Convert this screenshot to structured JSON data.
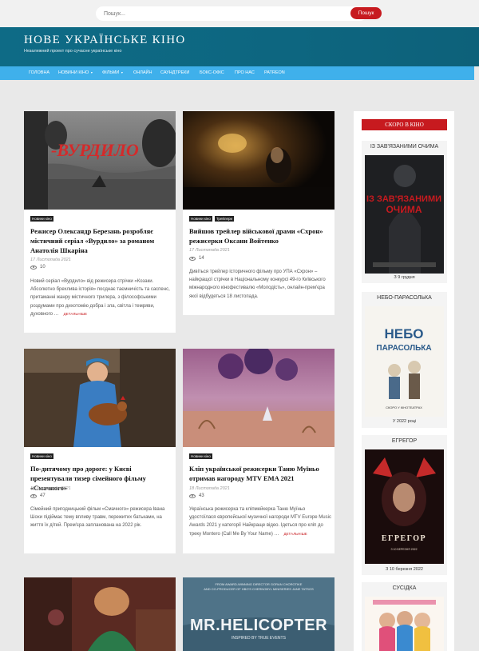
{
  "search": {
    "placeholder": "Пошук...",
    "button": "Пошук"
  },
  "site": {
    "title": "НОВЕ УКРАЇНСЬКЕ КІНО",
    "tagline": "Незалежний проект про сучасне українське кіно"
  },
  "nav": {
    "items": [
      {
        "label": "Головна",
        "dropdown": false
      },
      {
        "label": "Новини кіно",
        "dropdown": true
      },
      {
        "label": "Фільми",
        "dropdown": true
      },
      {
        "label": "Онлайн",
        "dropdown": false
      },
      {
        "label": "Саундтреки",
        "dropdown": false
      },
      {
        "label": "Бокс-офіс",
        "dropdown": false
      },
      {
        "label": "Про нас",
        "dropdown": false
      },
      {
        "label": "Patreon",
        "dropdown": false
      }
    ],
    "caret": "▾"
  },
  "posts": [
    {
      "categories": [
        "Новини кіно"
      ],
      "title": "Режисер Олександр Березань розробляє містичний серіал «Вурдило» за романом Анатолія Шкаріна",
      "date": "17 Листопада 2021",
      "views": "10",
      "excerpt": "Новий серіал «Вурдило» від режисера стрічки «Козаки. Абсолютно брехлива історія» посднає таємничість та саспенс, притаманні жанру містичного трилера, з філософськими роздумами про дихотомію добра і зла, світла і темряви, духовного …",
      "read_more": "Детальніше",
      "image_text": "-ВУРДИЛО"
    },
    {
      "categories": [
        "Новини кіно",
        "Трейлери"
      ],
      "title": "Вийшов трейлер військової драми «Схрон» режисерки Оксани Войтенко",
      "date": "17 Листопада 2021",
      "views": "14",
      "excerpt": "Дивіться трейлер історичного фільму про УПА «Схрон» – найкращої стрічки в Національному конкурсі 49-го Київського міжнародного кінофестивалю «Молодість», онлайн-прем'єра якої відбудеться 18 листопада.",
      "read_more": ""
    },
    {
      "categories": [
        "Новини кіно"
      ],
      "title": "По-дитячому про дороге: у Києві презентували тизер сімейного фільму «Смачного»",
      "date": "18 Листопада 2021",
      "views": "47",
      "excerpt": "Сімейний пригодницький фільм «Смачного» режисера Івана Шохи підіймає тему впливу травм, пережитих батьками, на життя їх дітей. Прем'єра запланована на 2022 рік.",
      "read_more": ""
    },
    {
      "categories": [
        "Новини кіно"
      ],
      "title": "Кліп української режисерки Таню Муїньо отримав нагороду MTV EMA 2021",
      "date": "18 Листопада 2021",
      "views": "43",
      "excerpt": "Українська режисерка та кліпмейкерка Таню Муїньо удостоїлася європейської музичної нагороди MTV Europe Music Awards 2021 у категорії Найкраще відео. Ідеться про кліп до треку Montero (Call Me By Your Name) …",
      "read_more": "Детальніше"
    },
    {
      "image_text": ""
    },
    {
      "image_text_top": "FROM AWARD-WINNING DIRECTOR GORAN CHOROTIKE\nAND CO-PRODUCER OF HBO'S CHERNOBYL MINISERIES JANE TATSOS",
      "image_title": "MR.HELICOPTER",
      "image_sub": "INSPIRED BY TRUE EVENTS"
    }
  ],
  "sidebar": {
    "title": "Скоро в кіно",
    "movies": [
      {
        "title": "Із зав'язаними очима",
        "date": "З 9 грудня",
        "poster_text": "ІЗ ЗАВ'ЯЗАНИМИ ОЧИМА",
        "poster_color": "#c71a1f"
      },
      {
        "title": "Небо-парасолька",
        "date": "У 2022 році",
        "poster_text": "НЕБО ПАРАСОЛЬКА",
        "poster_sub": "СКОРО У КІНОТЕАТРАХ"
      },
      {
        "title": "Егрегор",
        "date": "З 10 березня 2022",
        "poster_text": "ЕГРЕГОР",
        "poster_sub": "З 10 БЕРЕЗНЯ 2022"
      },
      {
        "title": "Сусідка",
        "date": "",
        "poster_text": ""
      }
    ]
  }
}
